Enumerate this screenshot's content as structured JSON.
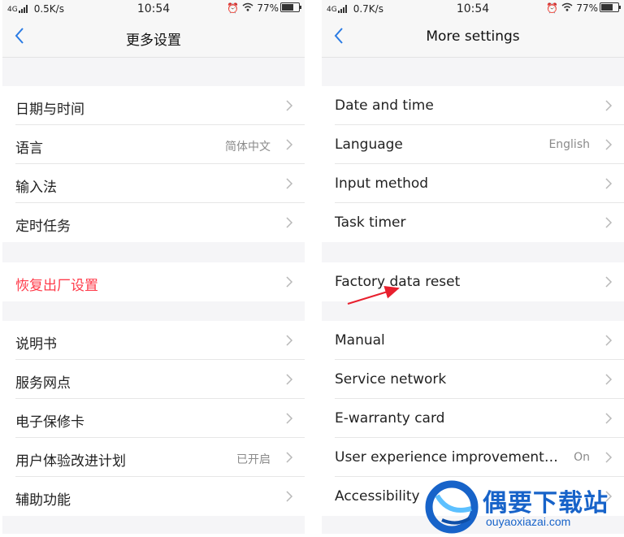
{
  "left": {
    "status": {
      "network": "4G",
      "speed": "0.5K/s",
      "time": "10:54",
      "battery_pct": "77%",
      "battery_level": 0.77
    },
    "title": "更多设置",
    "group1": [
      {
        "label": "日期与时间",
        "value": ""
      },
      {
        "label": "语言",
        "value": "简体中文"
      },
      {
        "label": "输入法",
        "value": ""
      },
      {
        "label": "定时任务",
        "value": ""
      }
    ],
    "group2": [
      {
        "label": "恢复出厂设置",
        "value": ""
      }
    ],
    "group3": [
      {
        "label": "说明书",
        "value": ""
      },
      {
        "label": "服务网点",
        "value": ""
      },
      {
        "label": "电子保修卡",
        "value": ""
      },
      {
        "label": "用户体验改进计划",
        "value": "已开启"
      },
      {
        "label": "辅助功能",
        "value": ""
      }
    ]
  },
  "right": {
    "status": {
      "network": "4G",
      "speed": "0.7K/s",
      "time": "10:54",
      "battery_pct": "77%",
      "battery_level": 0.77
    },
    "title": "More settings",
    "group1": [
      {
        "label": "Date and time",
        "value": ""
      },
      {
        "label": "Language",
        "value": "English"
      },
      {
        "label": "Input method",
        "value": ""
      },
      {
        "label": "Task timer",
        "value": ""
      }
    ],
    "group2": [
      {
        "label": "Factory data reset",
        "value": ""
      }
    ],
    "group3": [
      {
        "label": "Manual",
        "value": ""
      },
      {
        "label": "Service network",
        "value": ""
      },
      {
        "label": "E-warranty card",
        "value": ""
      },
      {
        "label": "User experience improvement…",
        "value": "On"
      },
      {
        "label": "Accessibility",
        "value": ""
      }
    ]
  },
  "colors": {
    "accent": "#2a7be4",
    "danger": "#ff3b4a",
    "arrow": "#e8202e",
    "watermark": "#1763c9"
  },
  "watermark": {
    "text": "偶要下载站",
    "url": "ouyaoxiazai.com"
  }
}
